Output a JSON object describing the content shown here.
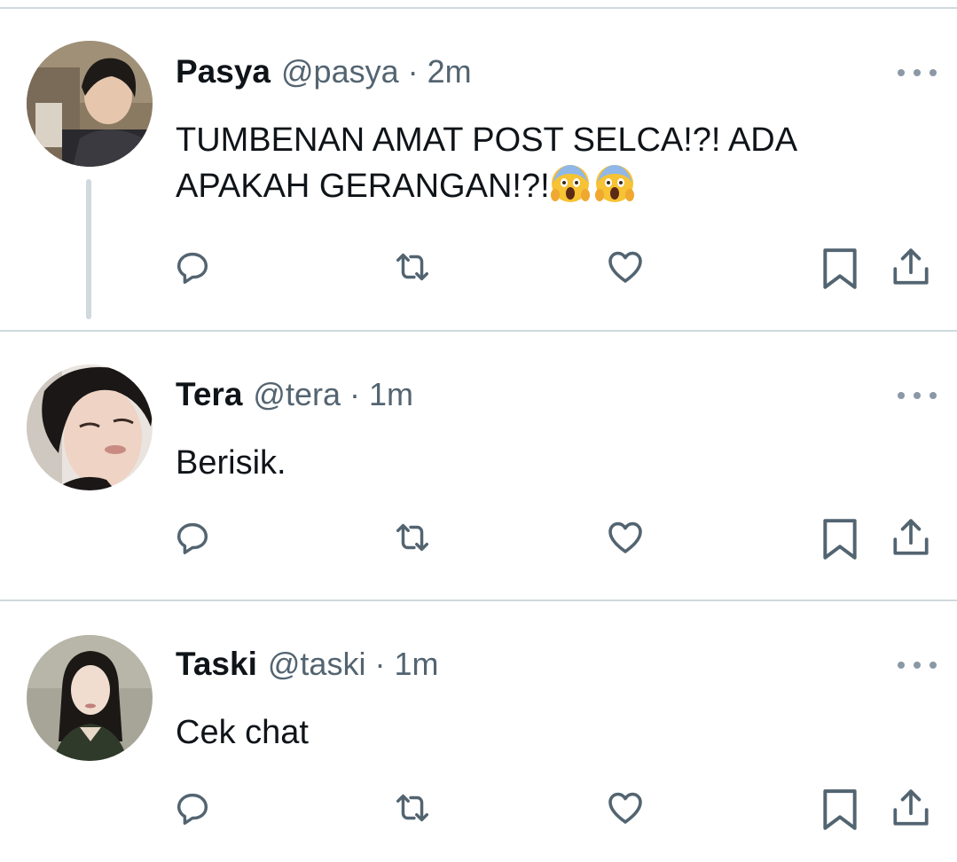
{
  "tweets": [
    {
      "name": "Pasya",
      "handle": "@pasya",
      "separator": "·",
      "time": "2m",
      "text": "TUMBENAN AMAT POST SELCA!?! ADA APAKAH GERANGAN!?!",
      "emoji_count": 2
    },
    {
      "name": "Tera",
      "handle": "@tera",
      "separator": "·",
      "time": "1m",
      "text": "Berisik."
    },
    {
      "name": "Taski",
      "handle": "@taski",
      "separator": "·",
      "time": "1m",
      "text": "Cek chat"
    }
  ],
  "colors": {
    "text_primary": "#0f1419",
    "text_secondary": "#536471",
    "divider": "#cfd9de",
    "icon": "#536471"
  },
  "icons": [
    "reply-icon",
    "retweet-icon",
    "like-icon",
    "bookmark-icon",
    "share-icon",
    "more-icon",
    "face-screaming-in-fear-emoji"
  ]
}
